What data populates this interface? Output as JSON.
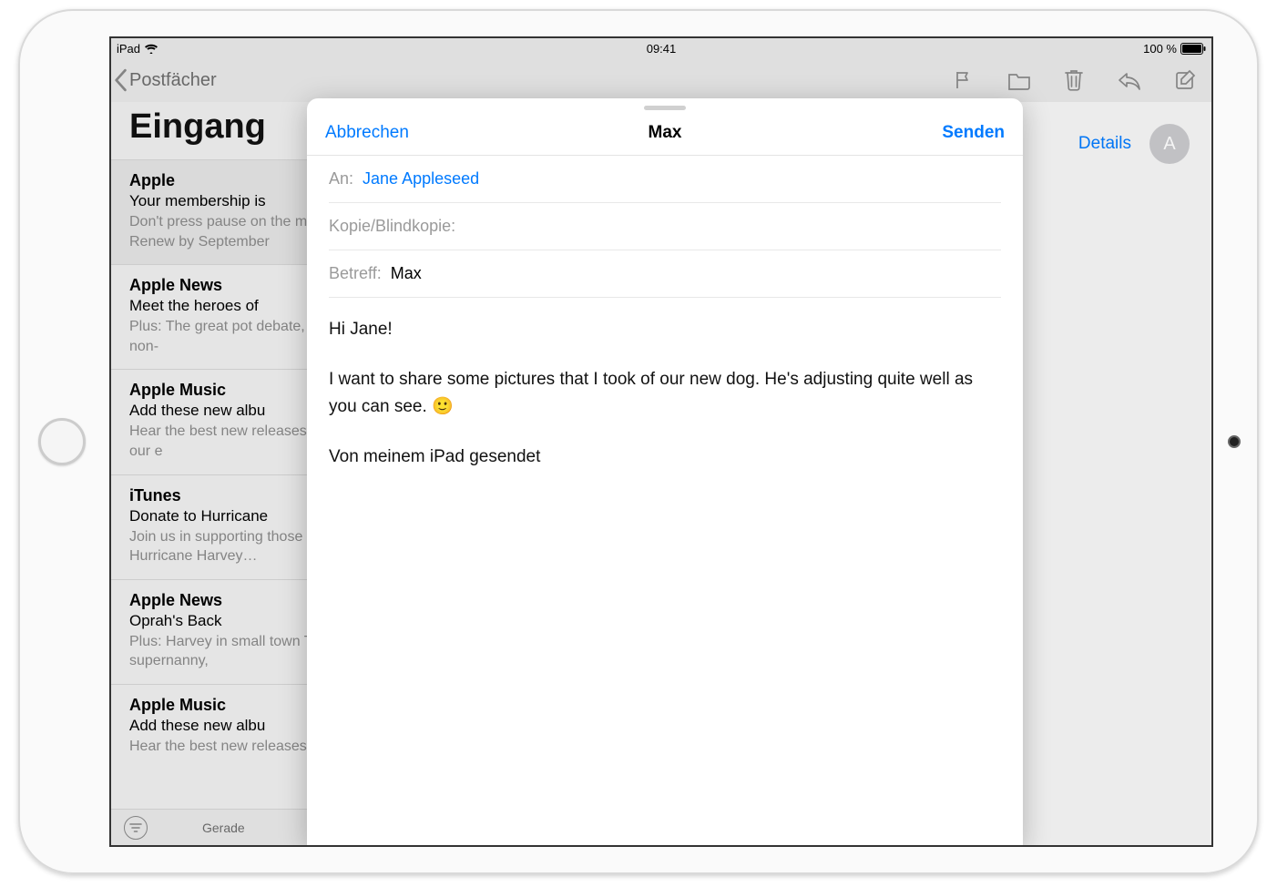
{
  "status_bar": {
    "device": "iPad",
    "time": "09:41",
    "battery": "100 %"
  },
  "nav": {
    "back_label": "Postfächer"
  },
  "sidebar": {
    "title": "Eingang",
    "footer_status": "Gerade",
    "messages": [
      {
        "from": "Apple",
        "subject": "Your membership is",
        "preview": "Don't press pause on the music you love. Renew by September"
      },
      {
        "from": "Apple News",
        "subject": "Meet the heroes of",
        "preview": "Plus: The great pot debate, Kathy Griffin's non-"
      },
      {
        "from": "Apple Music",
        "subject": "Add these new albu",
        "preview": "Hear the best new releases every week by our e"
      },
      {
        "from": "iTunes",
        "subject": "Donate to Hurricane",
        "preview": "Join us in supporting those affected by Hurricane Harvey…"
      },
      {
        "from": "Apple News",
        "subject": "Oprah's Back",
        "preview": "Plus: Harvey in small town Texas, virtual supernanny,"
      },
      {
        "from": "Apple Music",
        "subject": "Add these new albu",
        "preview": "Hear the best new releases"
      }
    ]
  },
  "main": {
    "details_label": "Details",
    "avatar_initial": "A"
  },
  "compose": {
    "cancel_label": "Abbrechen",
    "send_label": "Senden",
    "title": "Max",
    "to_label": "An:",
    "recipient": "Jane Appleseed",
    "cc_label": "Kopie/Blindkopie:",
    "subject_label": "Betreff:",
    "subject_value": "Max",
    "body_line1": "Hi Jane!",
    "body_line2": "I want to share some pictures that I took of our new dog. He's adjusting quite well as you can see. 🙂",
    "signature": "Von meinem iPad gesendet"
  }
}
